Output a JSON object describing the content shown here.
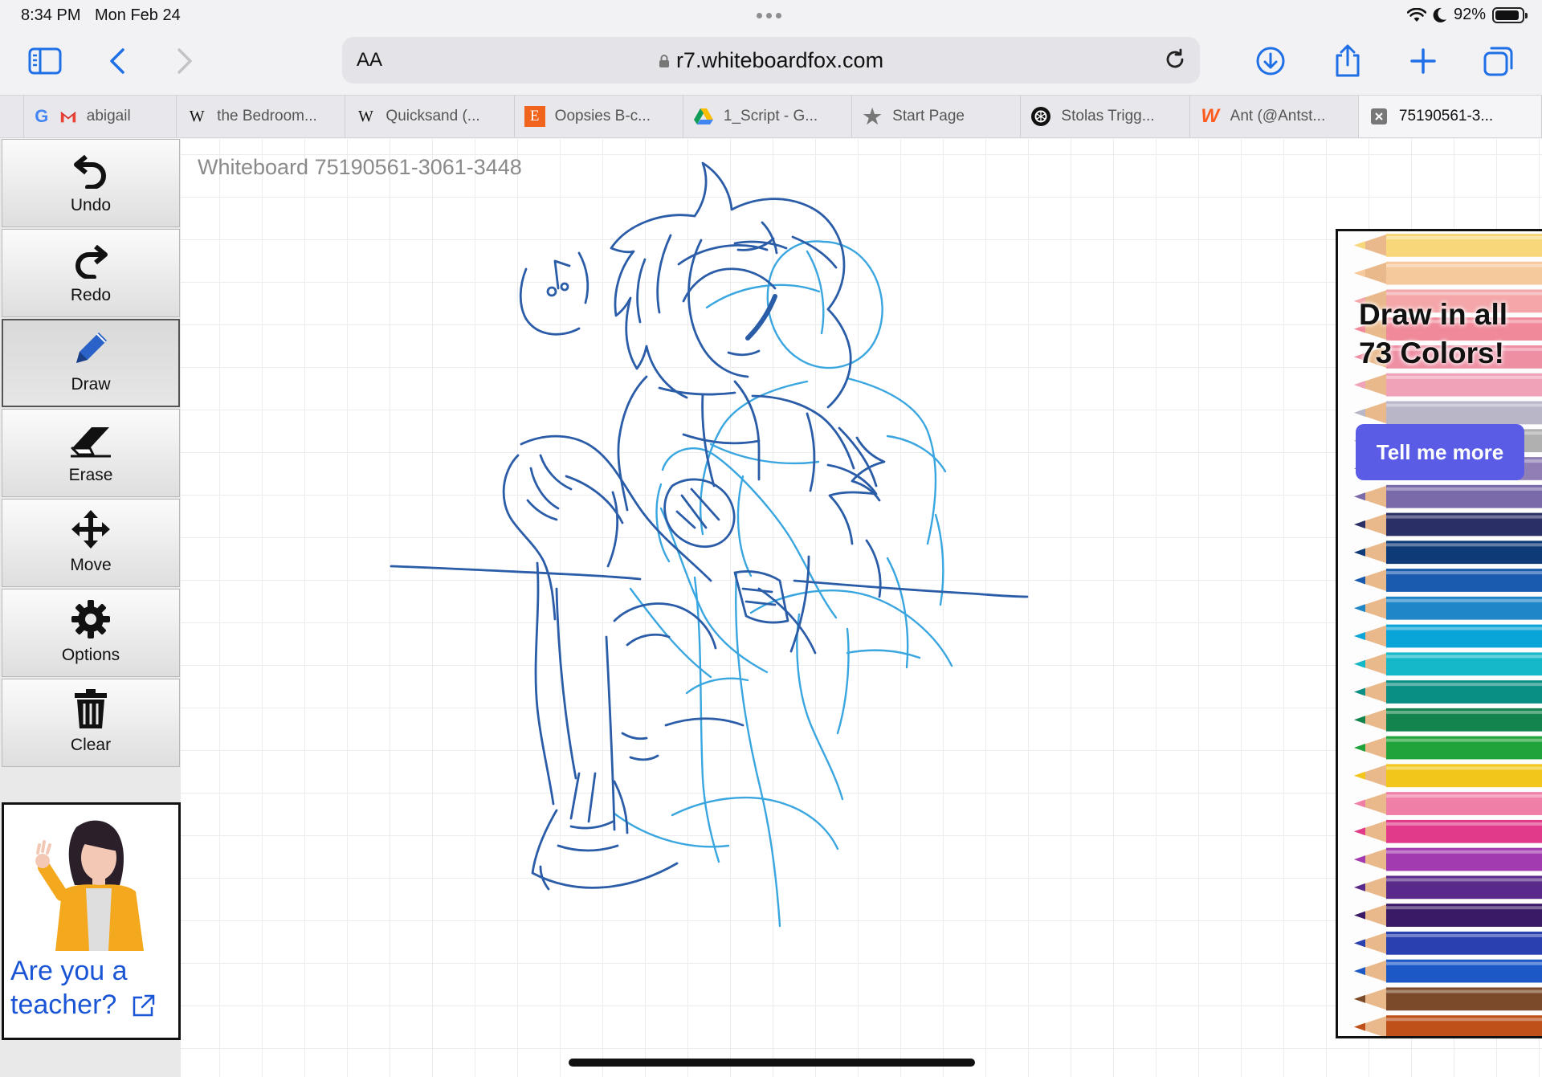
{
  "status": {
    "time": "8:34 PM",
    "date": "Mon Feb 24",
    "battery": "92%",
    "battery_level": 0.92
  },
  "browser": {
    "aa_label": "AA",
    "url": "r7.whiteboardfox.com",
    "tabs": [
      {
        "label": "abigail",
        "icon": "google-gmail-icon"
      },
      {
        "label": "the Bedroom...",
        "icon": "wikipedia-icon"
      },
      {
        "label": "Quicksand (...",
        "icon": "wikipedia-icon"
      },
      {
        "label": "Oopsies B-c...",
        "icon": "etsy-icon"
      },
      {
        "label": "1_Script - G...",
        "icon": "google-drive-icon"
      },
      {
        "label": "Start Page",
        "icon": "star-icon"
      },
      {
        "label": "Stolas Trigg...",
        "icon": "openai-icon"
      },
      {
        "label": "Ant (@Antst...",
        "icon": "wattpad-icon"
      },
      {
        "label": "75190561-3...",
        "icon": "close-icon"
      }
    ]
  },
  "board": {
    "title": "Whiteboard 75190561-3061-3448"
  },
  "tools": [
    {
      "label": "Undo",
      "icon": "undo-icon"
    },
    {
      "label": "Redo",
      "icon": "redo-icon"
    },
    {
      "label": "Draw",
      "icon": "pencil-icon",
      "active": true
    },
    {
      "label": "Erase",
      "icon": "eraser-icon"
    },
    {
      "label": "Move",
      "icon": "move-icon"
    },
    {
      "label": "Options",
      "icon": "gear-icon"
    },
    {
      "label": "Clear",
      "icon": "trash-icon"
    }
  ],
  "teacher_ad": {
    "link": "Are you a teacher?"
  },
  "color_ad": {
    "title": "Draw in all 73 Colors!",
    "button": "Tell me more"
  },
  "colors": {
    "ink_dark": "#2a5ca8",
    "ink_light": "#3aa6e0",
    "ad_button": "#5b5ce6",
    "link": "#1a55d6",
    "pencils": [
      "#f7d77a",
      "#f6c99c",
      "#f4a6a8",
      "#f08a9a",
      "#ee8fa4",
      "#f0a3b8",
      "#b9b6c8",
      "#b0b0b0",
      "#8f7fb4",
      "#7a6aa9",
      "#2a2f66",
      "#0f3a78",
      "#1a5bb0",
      "#1f86c7",
      "#0aa5d8",
      "#15b8c8",
      "#0a8f84",
      "#13844e",
      "#1fa33a",
      "#f2c61a",
      "#f07fa8",
      "#e13a8a",
      "#a33bb0",
      "#5a2a8a",
      "#3a1a66",
      "#2a3fb0",
      "#1c58c6",
      "#7a4a2a",
      "#c0501a"
    ]
  }
}
